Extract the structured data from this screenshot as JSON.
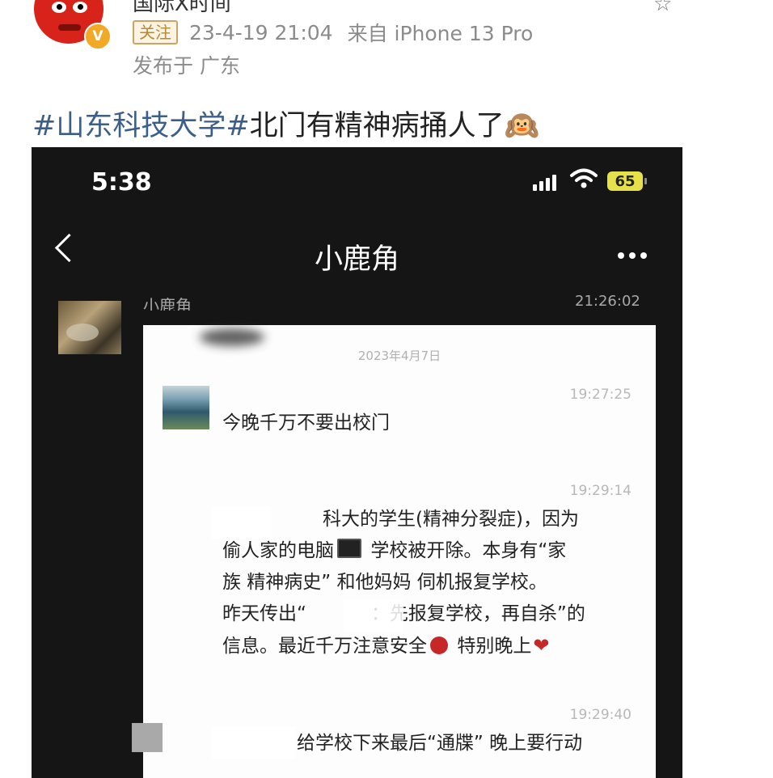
{
  "post": {
    "author_partial": "国际X时间",
    "follow_label": "关注",
    "timestamp": "23-4-19 21:04",
    "source": "来自 iPhone 13 Pro",
    "location": "发布于 广东",
    "hashtag": "#山东科技大学#",
    "text": "北门有精神病捅人了",
    "emoji": "🙉"
  },
  "phone": {
    "clock": "5:38",
    "battery": "65",
    "chat_title": "小鹿角",
    "sender_name": "小鹿角",
    "sender_time": "21:26:02"
  },
  "inner_chat": {
    "date": "2023年4月7日",
    "messages": [
      {
        "time": "19:27:25",
        "text": "今晚千万不要出校门"
      },
      {
        "time": "19:29:14",
        "lines": [
          "科大的学生(精神分裂症)，因为",
          "偷人家的电脑",
          "学校被开除。本身有“家",
          "族 精神病史”  和他妈妈 伺机报复学校。",
          "昨天传出“",
          "：先报复学校，再自杀”的",
          "信息。最近千万注意安全",
          "特别晚上"
        ]
      },
      {
        "time": "19:29:40",
        "text": "给学校下来最后“通牒” 晚上要行动"
      }
    ]
  }
}
